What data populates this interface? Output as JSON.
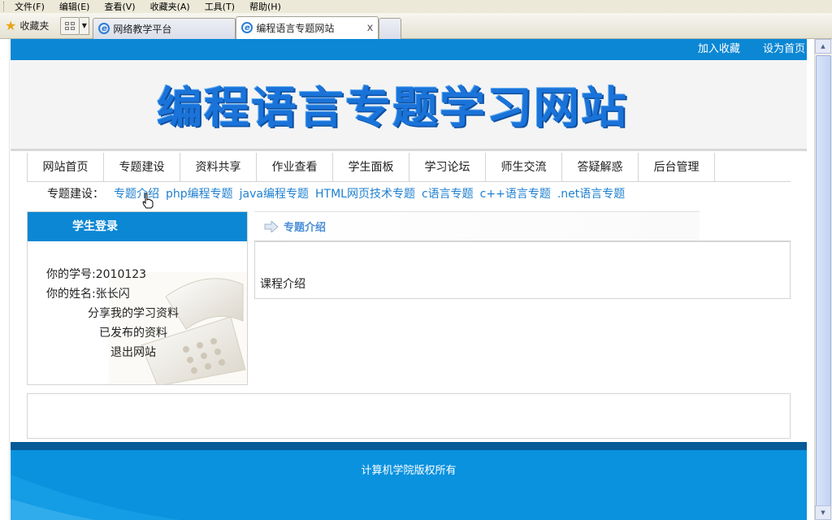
{
  "browser": {
    "menu": [
      "文件(F)",
      "编辑(E)",
      "查看(V)",
      "收藏夹(A)",
      "工具(T)",
      "帮助(H)"
    ],
    "favorites_label": "收藏夹",
    "tabs": [
      {
        "title": "网络教学平台",
        "active": false
      },
      {
        "title": "编程语言专题网站",
        "active": true
      }
    ],
    "close_glyph": "x"
  },
  "page": {
    "top_links": [
      "加入收藏",
      "设为首页"
    ],
    "banner_title": "编程语言专题学习网站",
    "nav": [
      "网站首页",
      "专题建设",
      "资料共享",
      "作业查看",
      "学生面板",
      "学习论坛",
      "师生交流",
      "答疑解惑",
      "后台管理"
    ],
    "subnav": {
      "label": "专题建设：",
      "links": [
        "专题介绍",
        "php编程专题",
        "java编程专题",
        "HTML网页技术专题",
        "c语言专题",
        "c++语言专题",
        ".net语言专题"
      ]
    },
    "login": {
      "title": "学生登录",
      "student_id": "你的学号:2010123",
      "student_name": "你的姓名:张长闪",
      "share_link": "分享我的学习资料",
      "published_link": "已发布的资料",
      "logout_link": "退出网站"
    },
    "content": {
      "section_title": "专题介绍",
      "body_text": "课程介绍"
    },
    "footer": "计算机学院版权所有"
  },
  "colors": {
    "brand_blue": "#0b87d4",
    "link_blue": "#1e7fd0",
    "footer_dark": "#055a98"
  }
}
